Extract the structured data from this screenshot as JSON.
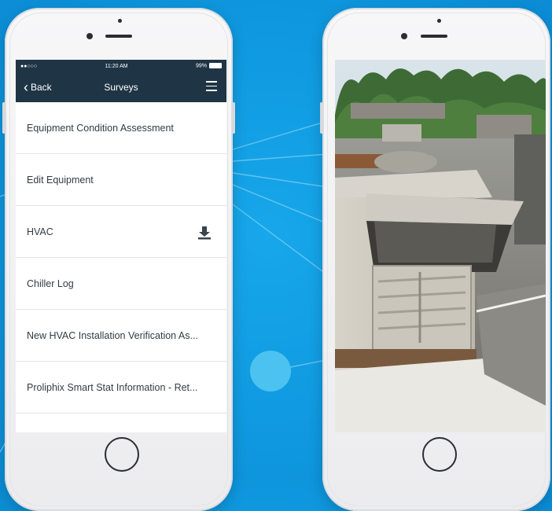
{
  "left_phone": {
    "status_bar": {
      "signal": "●●○○○",
      "time": "11:20 AM",
      "battery": "99%"
    },
    "nav": {
      "back_label": "Back",
      "title": "Surveys"
    },
    "surveys": [
      {
        "label": "Equipment Condition Assessment"
      },
      {
        "label": "Edit Equipment"
      },
      {
        "label": "HVAC",
        "icon": "download-icon"
      },
      {
        "label": "Chiller Log"
      },
      {
        "label": "New HVAC Installation Verification As..."
      },
      {
        "label": "Proliphix Smart Stat Information - Ret..."
      },
      {
        "label": ""
      }
    ]
  },
  "right_phone": {
    "photo": "rooftop-hvac-unit"
  },
  "colors": {
    "background": "#0f98df",
    "nav_bar": "#1f3546",
    "bubble": "#4cc2f1"
  }
}
